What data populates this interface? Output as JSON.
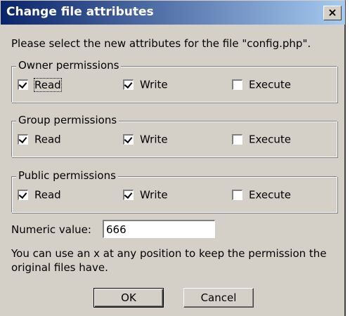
{
  "window": {
    "title": "Change file attributes",
    "close_label": "×"
  },
  "instruction": "Please select the new attributes for the file \"config.php\".",
  "groups": [
    {
      "legend": "Owner permissions",
      "read": {
        "label": "Read",
        "checked": true
      },
      "write": {
        "label": "Write",
        "checked": true
      },
      "execute": {
        "label": "Execute",
        "checked": false
      }
    },
    {
      "legend": "Group permissions",
      "read": {
        "label": "Read",
        "checked": true
      },
      "write": {
        "label": "Write",
        "checked": true
      },
      "execute": {
        "label": "Execute",
        "checked": false
      }
    },
    {
      "legend": "Public permissions",
      "read": {
        "label": "Read",
        "checked": true
      },
      "write": {
        "label": "Write",
        "checked": true
      },
      "execute": {
        "label": "Execute",
        "checked": false
      }
    }
  ],
  "numeric": {
    "label": "Numeric value:",
    "value": "666"
  },
  "help_text": "You can use an x at any position to keep the permission the original files have.",
  "buttons": {
    "ok": "OK",
    "cancel": "Cancel"
  },
  "colors": {
    "titlebar_start": "#0a246a",
    "titlebar_end": "#a6caf0",
    "face": "#d4d0c8"
  }
}
